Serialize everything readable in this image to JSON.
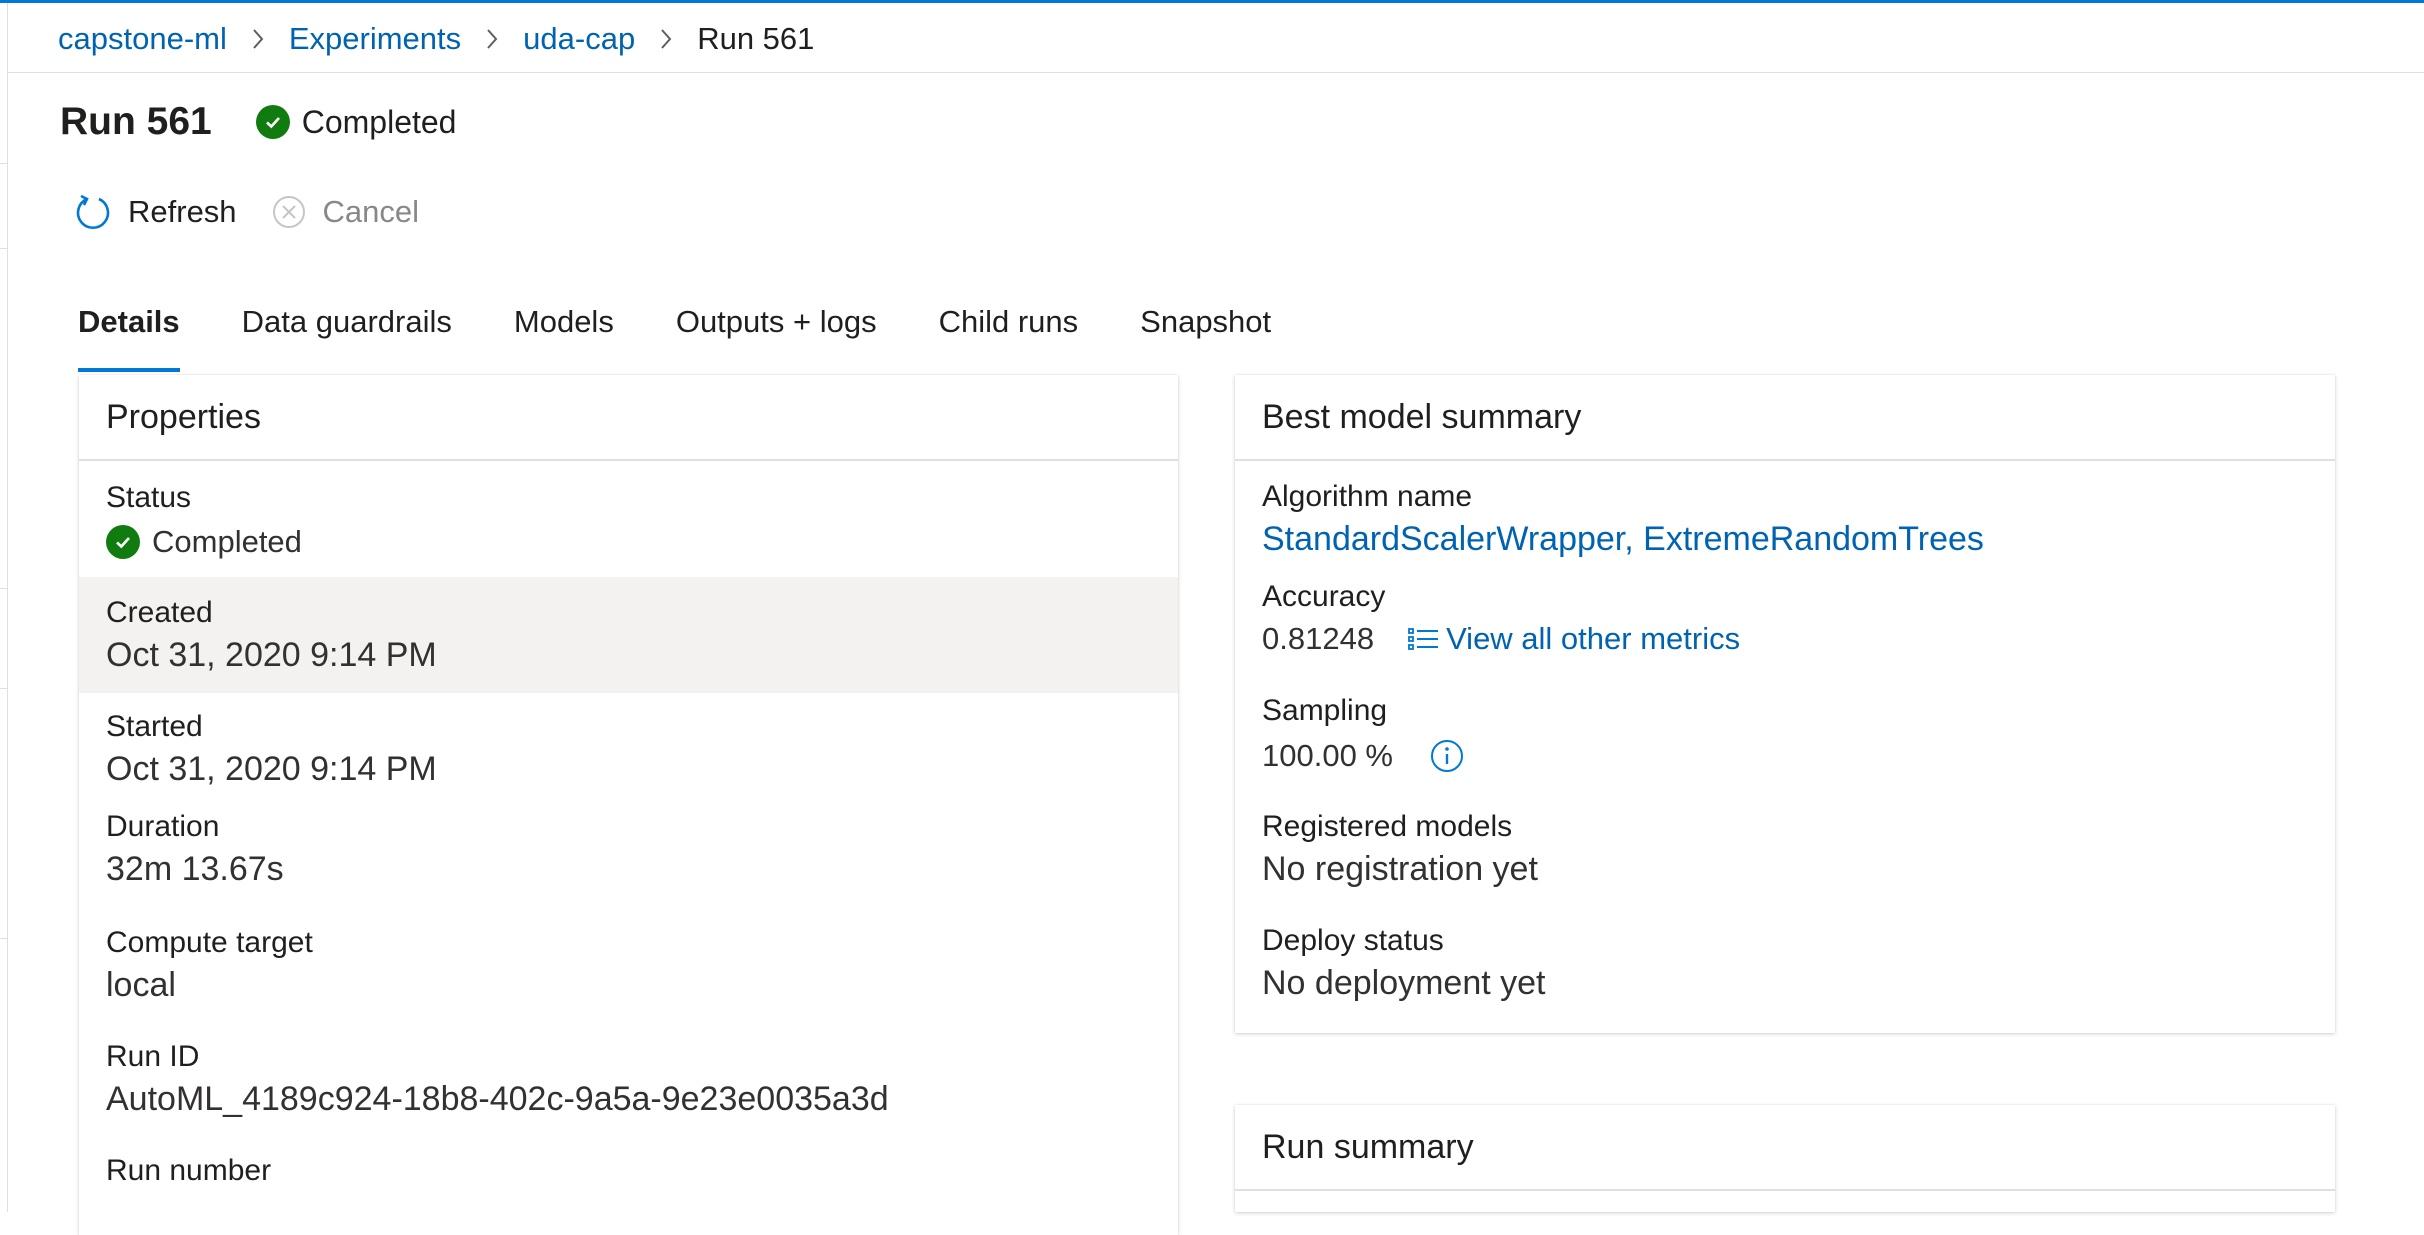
{
  "breadcrumb": {
    "items": [
      "capstone-ml",
      "Experiments",
      "uda-cap"
    ],
    "current": "Run 561"
  },
  "header": {
    "title": "Run 561",
    "status": "Completed"
  },
  "toolbar": {
    "refresh_label": "Refresh",
    "cancel_label": "Cancel"
  },
  "tabs": [
    {
      "label": "Details",
      "active": true
    },
    {
      "label": "Data guardrails"
    },
    {
      "label": "Models"
    },
    {
      "label": "Outputs + logs"
    },
    {
      "label": "Child runs"
    },
    {
      "label": "Snapshot"
    }
  ],
  "properties": {
    "title": "Properties",
    "status_label": "Status",
    "status_value": "Completed",
    "created_label": "Created",
    "created_value": "Oct 31, 2020 9:14 PM",
    "started_label": "Started",
    "started_value": "Oct 31, 2020 9:14 PM",
    "duration_label": "Duration",
    "duration_value": "32m 13.67s",
    "compute_label": "Compute target",
    "compute_value": "local",
    "runid_label": "Run ID",
    "runid_value": "AutoML_4189c924-18b8-402c-9a5a-9e23e0035a3d",
    "runnumber_label": "Run number"
  },
  "best_model": {
    "title": "Best model summary",
    "algorithm_label": "Algorithm name",
    "algorithm_value": "StandardScalerWrapper, ExtremeRandomTrees",
    "accuracy_label": "Accuracy",
    "accuracy_value": "0.81248",
    "metrics_link": "View all other metrics",
    "sampling_label": "Sampling",
    "sampling_value": "100.00 %",
    "registered_label": "Registered models",
    "registered_value": "No registration yet",
    "deploy_label": "Deploy status",
    "deploy_value": "No deployment yet"
  },
  "run_summary": {
    "title": "Run summary"
  },
  "colors": {
    "accent": "#0078d4",
    "link": "#0063b1",
    "success": "#107c10"
  },
  "icons": [
    "chevron-right-icon",
    "check-circle-icon",
    "refresh-icon",
    "cancel-icon",
    "list-icon",
    "info-icon"
  ]
}
